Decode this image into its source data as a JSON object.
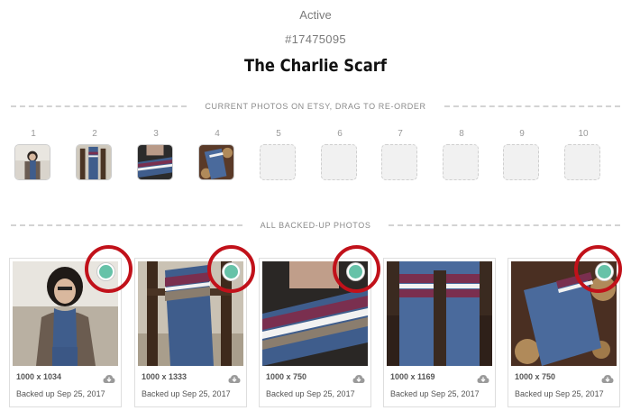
{
  "listing": {
    "status": "Active",
    "id": "#17475095",
    "title": "The Charlie Scarf"
  },
  "sections": {
    "current_photos": "CURRENT PHOTOS ON ETSY, DRAG TO RE-ORDER",
    "backed_up": "ALL BACKED-UP PHOTOS"
  },
  "slots": [
    {
      "number": "1",
      "filled": true
    },
    {
      "number": "2",
      "filled": true
    },
    {
      "number": "3",
      "filled": true
    },
    {
      "number": "4",
      "filled": true
    },
    {
      "number": "5",
      "filled": false
    },
    {
      "number": "6",
      "filled": false
    },
    {
      "number": "7",
      "filled": false
    },
    {
      "number": "8",
      "filled": false
    },
    {
      "number": "9",
      "filled": false
    },
    {
      "number": "10",
      "filled": false
    }
  ],
  "photos": [
    {
      "dimensions": "1000 x 1034",
      "backed_up": "Backed up Sep 25, 2017",
      "selected": true
    },
    {
      "dimensions": "1000 x 1333",
      "backed_up": "Backed up Sep 25, 2017",
      "selected": true
    },
    {
      "dimensions": "1000 x 750",
      "backed_up": "Backed up Sep 25, 2017",
      "selected": true
    },
    {
      "dimensions": "1000 x 1169",
      "backed_up": "Backed up Sep 25, 2017",
      "selected": false
    },
    {
      "dimensions": "1000 x 750",
      "backed_up": "Backed up Sep 25, 2017",
      "selected": true
    }
  ],
  "icons": {
    "download": "cloud-download-icon",
    "selected": "selected-dot-icon"
  },
  "colors": {
    "selected_dot": "#66c2a8",
    "highlight_ring": "#c1111a",
    "scarf_blue": "#4a6a9c",
    "scarf_burgundy": "#7a2f4f"
  }
}
